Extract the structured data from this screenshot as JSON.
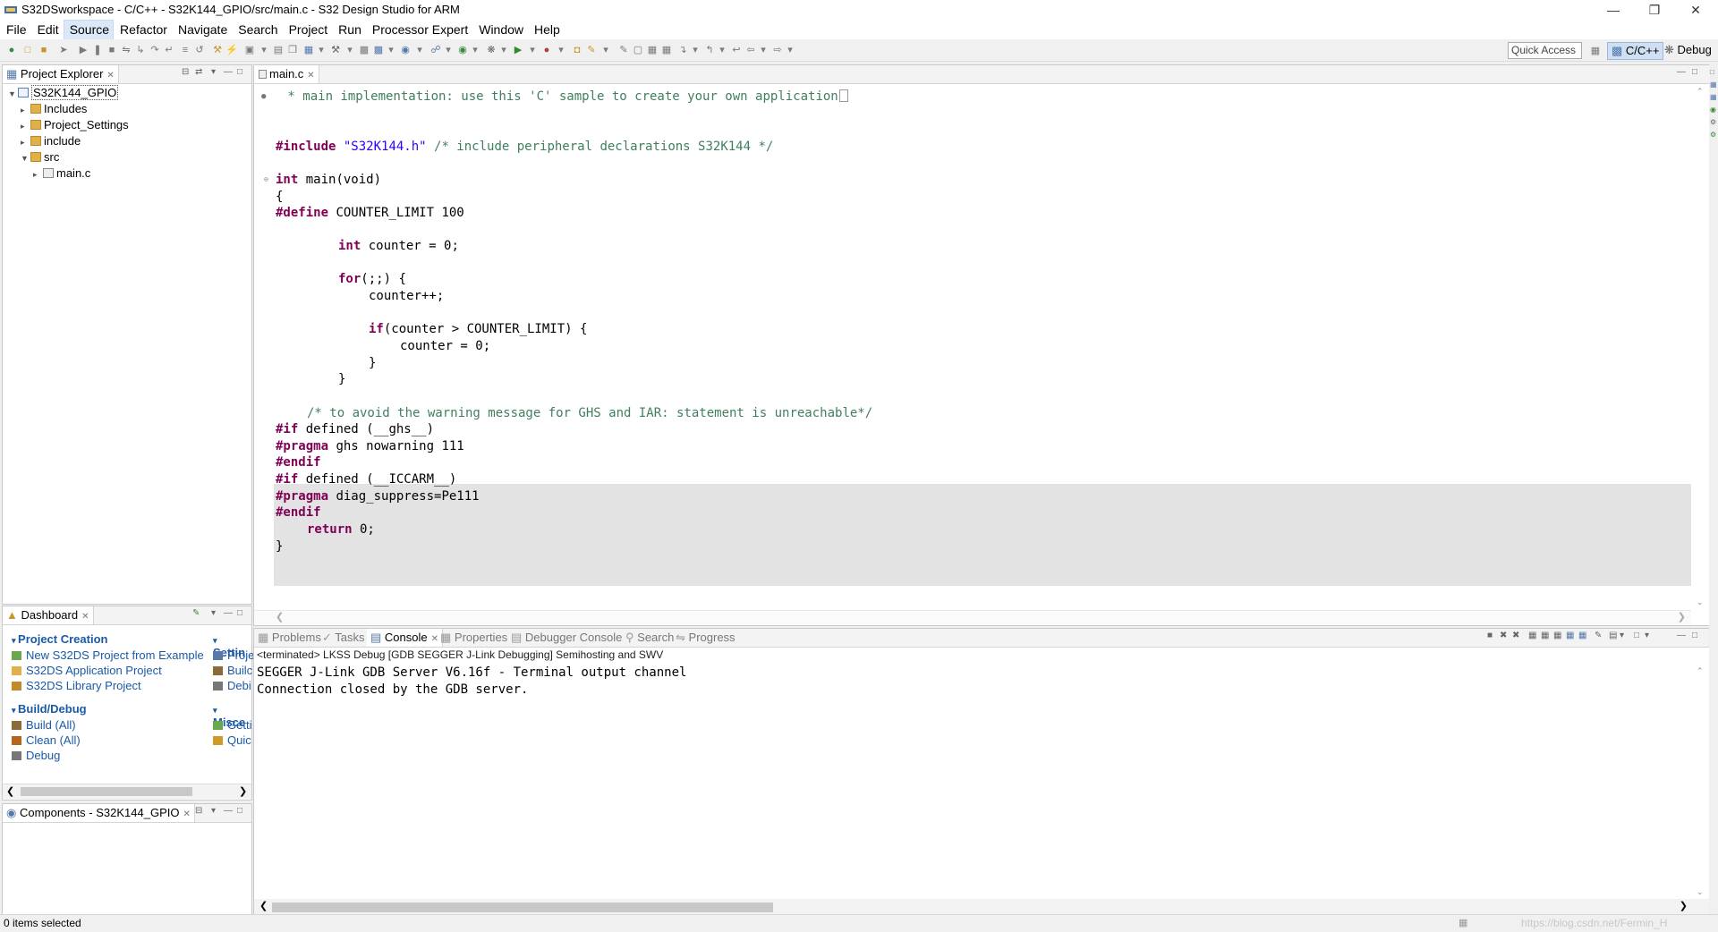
{
  "window": {
    "title": "S32DSworkspace - C/C++ - S32K144_GPIO/src/main.c - S32 Design Studio for ARM"
  },
  "menu": [
    "File",
    "Edit",
    "Source",
    "Refactor",
    "Navigate",
    "Search",
    "Project",
    "Run",
    "Processor Expert",
    "Window",
    "Help"
  ],
  "toolbar": {
    "quick_access": "Quick Access",
    "perspective_cpp": "C/C++",
    "perspective_debug": "Debug"
  },
  "project_explorer": {
    "tab": "Project Explorer",
    "project": "S32K144_GPIO",
    "items": [
      "Includes",
      "Project_Settings",
      "include",
      "src"
    ],
    "src_children": [
      "main.c"
    ]
  },
  "dashboard": {
    "tab": "Dashboard",
    "sections": [
      {
        "title": "Project Creation",
        "links": [
          "New S32DS Project from Example",
          "S32DS Application Project",
          "S32DS Library Project"
        ]
      },
      {
        "title": "Build/Debug",
        "links": [
          "Build  (All)",
          "Clean  (All)",
          "Debug"
        ]
      }
    ],
    "right_sections": [
      {
        "title": "Settin",
        "links": [
          "Proje",
          "Builc",
          "Debi"
        ]
      },
      {
        "title": "Misce",
        "links": [
          "Getti",
          "Quic"
        ]
      }
    ]
  },
  "components": {
    "tab": "Components - S32K144_GPIO"
  },
  "editor": {
    "tab": "main.c",
    "lines": {
      "l1": " * main implementation: use this 'C' sample to create your own application",
      "l2_pp": "#include",
      "l2_str": " \"S32K144.h\"",
      "l2_cmt": " /* include peripheral declarations S32K144 */",
      "l3_kw": "int",
      "l3_rest": " main(void)",
      "l4": "{",
      "l5_pp": "#define",
      "l5_rest": " COUNTER_LIMIT 100",
      "l6_kw": "int",
      "l6_rest": " counter = 0;",
      "l7_kw": "for",
      "l7_rest": "(;;) {",
      "l8": "counter++;",
      "l9_kw": "if",
      "l9_rest": "(counter > COUNTER_LIMIT) {",
      "l10": "counter = 0;",
      "l11": "}",
      "l12": "}",
      "l13": "/* to avoid the warning message for GHS and IAR: statement is unreachable*/",
      "l14_pp": "#if",
      "l14_rest": " defined (__ghs__)",
      "l15_pp": "#pragma",
      "l15_rest": " ghs nowarning 111",
      "l16_pp": "#endif",
      "l17_pp": "#if",
      "l17_rest": " defined (__ICCARM__)",
      "l18_pp": "#pragma",
      "l18_rest": " diag_suppress=Pe111",
      "l19_pp": "#endif",
      "l20_kw": "return",
      "l20_rest": " 0;",
      "l21": "}"
    }
  },
  "console": {
    "tabs": [
      "Problems",
      "Tasks",
      "Console",
      "Properties",
      "Debugger Console",
      "Search",
      "Progress"
    ],
    "active_tab": "Console",
    "description": "<terminated> LKSS Debug [GDB SEGGER J-Link Debugging] Semihosting and SWV",
    "output": [
      "SEGGER J-Link GDB Server V6.16f - Terminal output channel",
      "Connection closed by the GDB server."
    ]
  },
  "status": {
    "text": "0 items selected",
    "watermark": "https://blog.csdn.net/Fermin_H"
  }
}
